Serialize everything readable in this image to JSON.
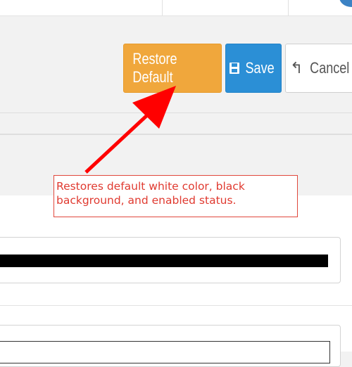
{
  "toolbar": {
    "restore_label": "Restore Default",
    "save_label": "Save",
    "cancel_label": "Cancel"
  },
  "annotation": {
    "text": "Restores default white color, black background, and enabled status."
  },
  "colors": {
    "restore": "#f0a73c",
    "save": "#2b8fd6",
    "annotation": "#e03a30"
  },
  "icons": {
    "save": "floppy-disk-icon",
    "cancel": "undo-arrow-icon"
  }
}
